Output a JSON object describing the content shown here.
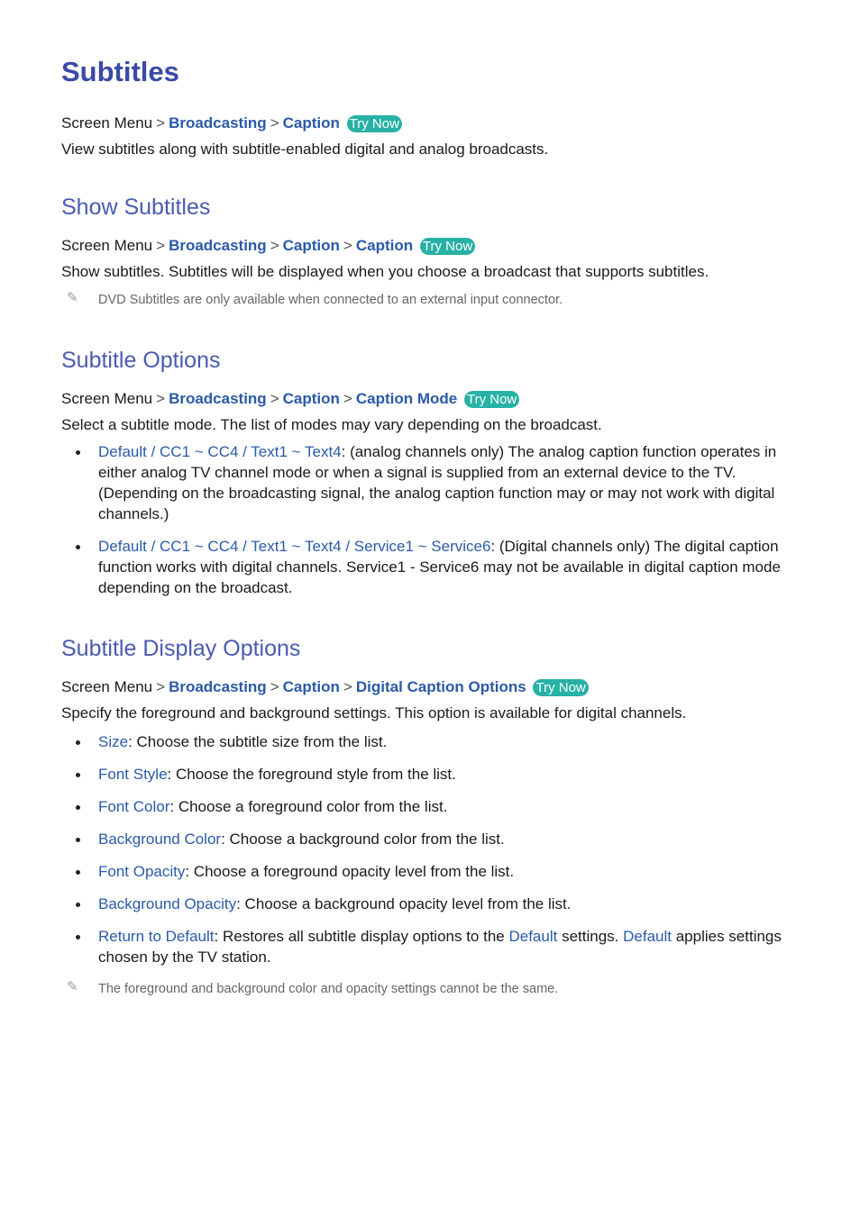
{
  "title": "Subtitles",
  "intro": {
    "crumb": [
      "Screen Menu",
      "Broadcasting",
      "Caption"
    ],
    "try_now": "Try Now",
    "text": "View subtitles along with subtitle-enabled digital and analog broadcasts."
  },
  "show": {
    "heading": "Show Subtitles",
    "crumb": [
      "Screen Menu",
      "Broadcasting",
      "Caption",
      "Caption"
    ],
    "try_now": "Try Now",
    "text": "Show subtitles. Subtitles will be displayed when you choose a broadcast that supports subtitles.",
    "note": "DVD Subtitles are only available when connected to an external input connector."
  },
  "options": {
    "heading": "Subtitle Options",
    "crumb": [
      "Screen Menu",
      "Broadcasting",
      "Caption",
      "Caption Mode"
    ],
    "try_now": "Try Now",
    "text": "Select a subtitle mode. The list of modes may vary depending on the broadcast.",
    "bullets": [
      {
        "terms": "Default / CC1 ~ CC4 / Text1 ~ Text4",
        "desc": ": (analog channels only) The analog caption function operates in either analog TV channel mode or when a signal is supplied from an external device to the TV. (Depending on the broadcasting signal, the analog caption function may or may not work with digital channels.)"
      },
      {
        "terms": "Default / CC1 ~ CC4 / Text1 ~ Text4 / Service1 ~ Service6",
        "desc": ": (Digital channels only) The digital caption function works with digital channels. Service1 - Service6 may not be available in digital caption mode depending on the broadcast."
      }
    ]
  },
  "display": {
    "heading": "Subtitle Display Options",
    "crumb": [
      "Screen Menu",
      "Broadcasting",
      "Caption",
      "Digital Caption Options"
    ],
    "try_now": "Try Now",
    "text": "Specify the foreground and background settings. This option is available for digital channels.",
    "bullets": [
      {
        "term": "Size",
        "desc": ": Choose the subtitle size from the list."
      },
      {
        "term": "Font Style",
        "desc": ": Choose the foreground style from the list."
      },
      {
        "term": "Font Color",
        "desc": ": Choose a foreground color from the list."
      },
      {
        "term": "Background Color",
        "desc": ": Choose a background color from the list."
      },
      {
        "term": "Font Opacity",
        "desc": ": Choose a foreground opacity level from the list."
      },
      {
        "term": "Background Opacity",
        "desc": ": Choose a background opacity level from the list."
      }
    ],
    "last_bullet": {
      "term": "Return to Default",
      "p1": ": Restores all subtitle display options to the ",
      "t2": "Default",
      "p2": " settings. ",
      "t3": "Default",
      "p3": " applies settings chosen by the TV station."
    },
    "note": "The foreground and background color and opacity settings cannot be the same."
  }
}
